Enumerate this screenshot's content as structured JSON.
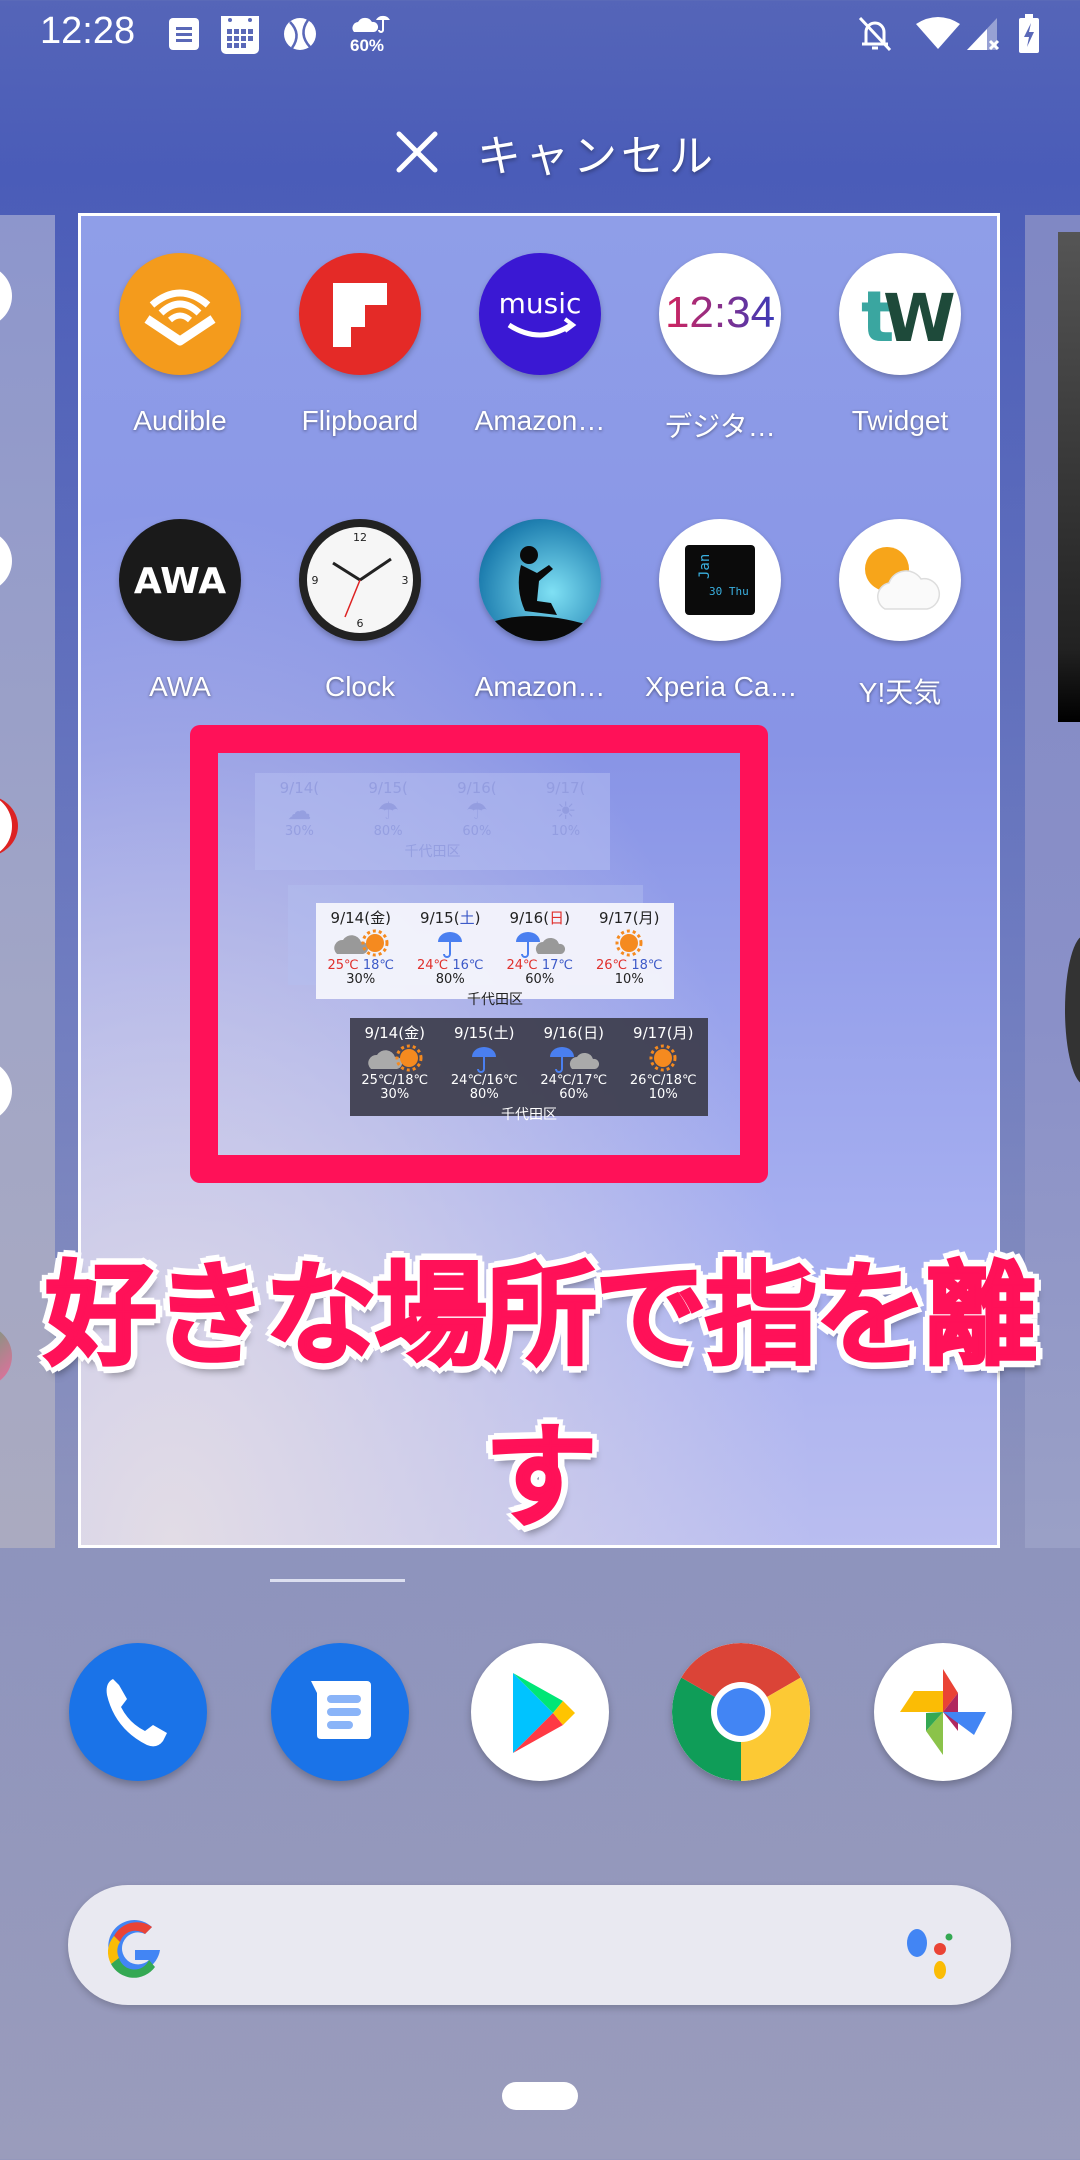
{
  "status_bar": {
    "time": "12:28",
    "left_icons": [
      "notes-icon",
      "calendar-icon",
      "tennis-ball-icon",
      "weather-umbrella-icon"
    ],
    "weather_rain_chance": "60%",
    "right_icons": [
      "dnd-bell-off-icon",
      "wifi-icon",
      "cell-signal-no-service-icon",
      "battery-charging-icon"
    ]
  },
  "cancel_bar": {
    "label": "キャンセル",
    "icon": "close-icon"
  },
  "home_apps": [
    {
      "label": "Audible",
      "icon": "audible-icon",
      "color": "#f49b1c"
    },
    {
      "label": "Flipboard",
      "icon": "flipboard-icon",
      "color": "#e42a27"
    },
    {
      "label": "Amazon…",
      "icon": "amazon-music-icon",
      "color": "#3a18d3"
    },
    {
      "label": "デジタ…",
      "icon": "digital-clock-icon",
      "color": "#ffffff"
    },
    {
      "label": "Twidget",
      "icon": "twidget-icon",
      "color": "#ffffff"
    },
    {
      "label": "AWA",
      "icon": "awa-icon",
      "color": "#1a1a1a"
    },
    {
      "label": "Clock",
      "icon": "analog-clock-icon",
      "color": "#ffffff"
    },
    {
      "label": "Amazon…",
      "icon": "kindle-icon",
      "color": "#2aa6d6"
    },
    {
      "label": "Xperia Ca…",
      "icon": "xperia-calendar-icon",
      "color": "#ffffff"
    },
    {
      "label": "Y!天気",
      "icon": "yahoo-weather-icon",
      "color": "#ffffff"
    }
  ],
  "widget": {
    "location": "千代田区",
    "days": [
      {
        "date": "9/14(",
        "dow": "金",
        "close": ")",
        "dow_color": "default",
        "weather": "cloudy-then-sunny",
        "high": "25℃",
        "low": "18℃",
        "pop": "30%"
      },
      {
        "date": "9/15(",
        "dow": "土",
        "close": ")",
        "dow_color": "#3d5ac8",
        "weather": "rain",
        "high": "24℃",
        "low": "16℃",
        "pop": "80%"
      },
      {
        "date": "9/16(",
        "dow": "日",
        "close": ")",
        "dow_color": "#e0302c",
        "weather": "rain-then-cloudy",
        "high": "24℃",
        "low": "17℃",
        "pop": "60%"
      },
      {
        "date": "9/17(",
        "dow": "月",
        "close": ")",
        "dow_color": "default",
        "weather": "sunny",
        "high": "26℃",
        "low": "18℃",
        "pop": "10%"
      }
    ],
    "dark_temps": [
      "25℃/18℃",
      "24℃/16℃",
      "24℃/17℃",
      "26℃/18℃"
    ]
  },
  "highlight_color": "#ff1158",
  "caption": "好きな場所で指を離す",
  "dock": [
    {
      "name": "phone",
      "icon": "phone-icon"
    },
    {
      "name": "messages",
      "icon": "messages-icon"
    },
    {
      "name": "play-store",
      "icon": "play-store-icon"
    },
    {
      "name": "chrome",
      "icon": "chrome-icon"
    },
    {
      "name": "photos",
      "icon": "google-photos-icon"
    }
  ],
  "search_bar": {
    "left_icon": "google-g-icon",
    "right_icon": "google-assistant-icon"
  }
}
